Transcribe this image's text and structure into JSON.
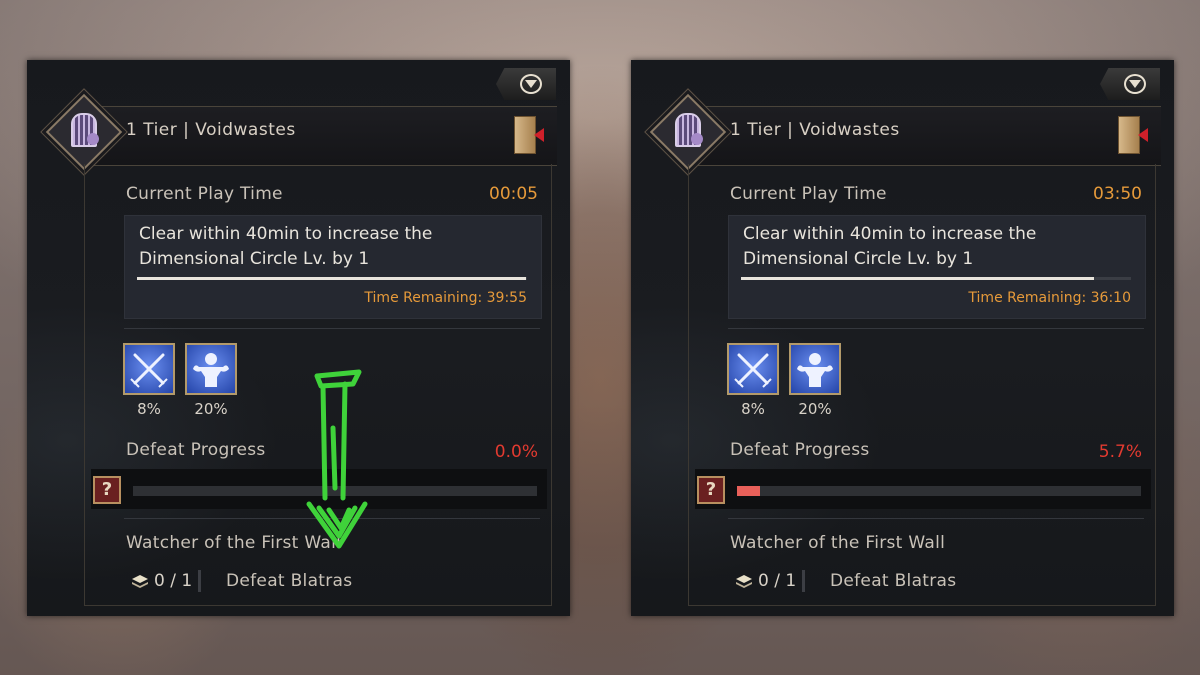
{
  "panels": [
    {
      "title": "1 Tier  |  Voidwastes",
      "play_time_label": "Current Play Time",
      "play_time": "00:05",
      "mission_text": "Clear within 40min to increase the Dimensional Circle Lv. by 1",
      "time_remaining": "Time Remaining: 39:55",
      "time_remaining_fraction": 0.998,
      "buffs": [
        {
          "icon": "crossed-swords-icon",
          "value": "8%"
        },
        {
          "icon": "muscle-strength-icon",
          "value": "20%"
        }
      ],
      "defeat_progress_label": "Defeat Progress",
      "defeat_progress": "0.0%",
      "defeat_progress_fraction": 0.0,
      "objective_title": "Watcher of the First Wall",
      "objective_count": "0 / 1",
      "objective_text": "Defeat Blatras"
    },
    {
      "title": "1 Tier  |  Voidwastes",
      "play_time_label": "Current Play Time",
      "play_time": "03:50",
      "mission_text": "Clear within 40min to increase the Dimensional Circle Lv. by 1",
      "time_remaining": "Time Remaining: 36:10",
      "time_remaining_fraction": 0.904,
      "buffs": [
        {
          "icon": "crossed-swords-icon",
          "value": "8%"
        },
        {
          "icon": "muscle-strength-icon",
          "value": "20%"
        }
      ],
      "defeat_progress_label": "Defeat Progress",
      "defeat_progress": "5.7%",
      "defeat_progress_fraction": 0.057,
      "objective_title": "Watcher of the First Wall",
      "objective_count": "0 / 1",
      "objective_text": "Defeat Blatras"
    }
  ],
  "colors": {
    "timer": "#e69a3a",
    "progress_text": "#e23a30",
    "progress_fill": "#e8605a",
    "annotation_arrow": "#3fd23a"
  }
}
